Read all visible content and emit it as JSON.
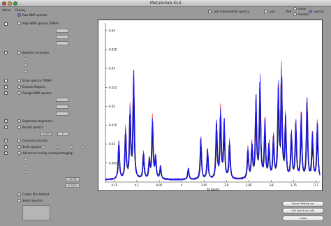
{
  "window": {
    "title": "Metabolab GUI"
  },
  "left_panel": {
    "col_active": "Active",
    "col_display": "Display",
    "raw_spectra": "Raw NMR spectra",
    "align_spectra": "Align NMR spectra (TMSP)",
    "baseline": "Baseline correction",
    "scale_spectra": "Scale spectra (TMSP)",
    "exclude_regions": "Exclude Regions",
    "realign_spectra": "Realign NMR spectra",
    "segmental_alignment": "Segmental alignment",
    "bucket_spectra": "Bucket spectra",
    "bucket_width": "0.005",
    "bucket_value2": "0",
    "compress_buckets": "Compress buckets",
    "scale_spectra2": "Scale spectra",
    "advanced_scaling": "Advanced scaling (auto/pareto/glog)",
    "glog_lambda": "1e-08",
    "glog_y0": "0.0001",
    "create_pls": "Create PLS dataset",
    "select_spectra": "Select spectra"
  },
  "top_controls": {
    "plot_intermediate": "plot intermediate spectra",
    "plot_label": "Plot",
    "mean_label": "mean",
    "median_label": "median",
    "spectra_label": "spectra",
    "pan_label": "pan"
  },
  "buttons": {
    "export": "Export Matlab sys",
    "get_info": "Get Spectrum Info",
    "close": "Close"
  },
  "chart_data": {
    "type": "line",
    "xlabel": "¹H [ppm]",
    "x_ticks": [
      "4.15",
      "4.1",
      "4.05",
      "4",
      "3.95",
      "3.9",
      "3.85",
      "3.8",
      "3.75",
      "3.7"
    ],
    "y_ticks": [
      "0.04",
      "0.035",
      "0.03",
      "0.025",
      "0.02",
      "0.015",
      "0.01",
      "0.005"
    ],
    "xlim": [
      4.17,
      3.69
    ],
    "ylim": [
      0,
      0.042
    ],
    "grid": false,
    "series_colors": [
      "#1a1aff",
      "#000000",
      "#ff2a2a"
    ],
    "peaks": [
      {
        "x": 4.14,
        "y": 0.01
      },
      {
        "x": 4.125,
        "y": 0.013
      },
      {
        "x": 4.115,
        "y": 0.018
      },
      {
        "x": 4.107,
        "y": 0.028
      },
      {
        "x": 4.085,
        "y": 0.007
      },
      {
        "x": 4.072,
        "y": 0.005
      },
      {
        "x": 4.065,
        "y": 0.016
      },
      {
        "x": 4.058,
        "y": 0.006
      },
      {
        "x": 4.047,
        "y": 0.0035
      },
      {
        "x": 3.985,
        "y": 0.003
      },
      {
        "x": 3.957,
        "y": 0.011
      },
      {
        "x": 3.942,
        "y": 0.008
      },
      {
        "x": 3.922,
        "y": 0.015
      },
      {
        "x": 3.913,
        "y": 0.018
      },
      {
        "x": 3.905,
        "y": 0.015
      },
      {
        "x": 3.893,
        "y": 0.01
      },
      {
        "x": 3.852,
        "y": 0.008
      },
      {
        "x": 3.843,
        "y": 0.009
      },
      {
        "x": 3.834,
        "y": 0.021
      },
      {
        "x": 3.825,
        "y": 0.026
      },
      {
        "x": 3.814,
        "y": 0.015
      },
      {
        "x": 3.805,
        "y": 0.009
      },
      {
        "x": 3.795,
        "y": 0.011
      },
      {
        "x": 3.784,
        "y": 0.024
      },
      {
        "x": 3.777,
        "y": 0.028
      },
      {
        "x": 3.768,
        "y": 0.016
      },
      {
        "x": 3.755,
        "y": 0.012
      },
      {
        "x": 3.745,
        "y": 0.015
      },
      {
        "x": 3.733,
        "y": 0.017
      },
      {
        "x": 3.72,
        "y": 0.021
      },
      {
        "x": 3.708,
        "y": 0.012
      },
      {
        "x": 3.697,
        "y": 0.015
      }
    ]
  }
}
